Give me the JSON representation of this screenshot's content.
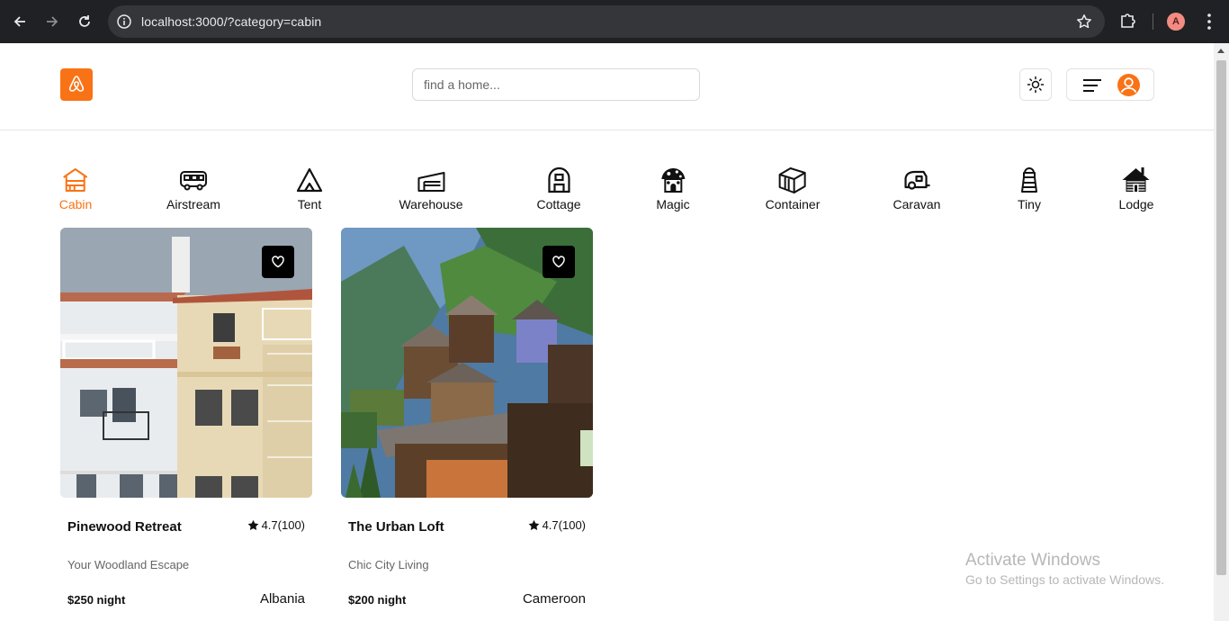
{
  "browser": {
    "url": "localhost:3000/?category=cabin",
    "profile_initial": "A"
  },
  "header": {
    "search_placeholder": "find a home..."
  },
  "colors": {
    "accent": "#f97316"
  },
  "categories": [
    {
      "label": "Cabin",
      "icon": "cabin-icon",
      "active": true
    },
    {
      "label": "Airstream",
      "icon": "bus-icon",
      "active": false
    },
    {
      "label": "Tent",
      "icon": "tent-icon",
      "active": false
    },
    {
      "label": "Warehouse",
      "icon": "warehouse-icon",
      "active": false
    },
    {
      "label": "Cottage",
      "icon": "cottage-icon",
      "active": false
    },
    {
      "label": "Magic",
      "icon": "mushroom-house-icon",
      "active": false
    },
    {
      "label": "Container",
      "icon": "container-icon",
      "active": false
    },
    {
      "label": "Caravan",
      "icon": "caravan-icon",
      "active": false
    },
    {
      "label": "Tiny",
      "icon": "lighthouse-icon",
      "active": false
    },
    {
      "label": "Lodge",
      "icon": "lodge-icon",
      "active": false
    }
  ],
  "listings": [
    {
      "name": "Pinewood Retreat",
      "rating": "4.7(100)",
      "tagline": "Your Woodland Escape",
      "price": "$250 night",
      "country": "Albania"
    },
    {
      "name": "The Urban Loft",
      "rating": "4.7(100)",
      "tagline": "Chic City Living",
      "price": "$200 night",
      "country": "Cameroon"
    }
  ],
  "watermark": {
    "title": "Activate Windows",
    "subtitle": "Go to Settings to activate Windows."
  }
}
